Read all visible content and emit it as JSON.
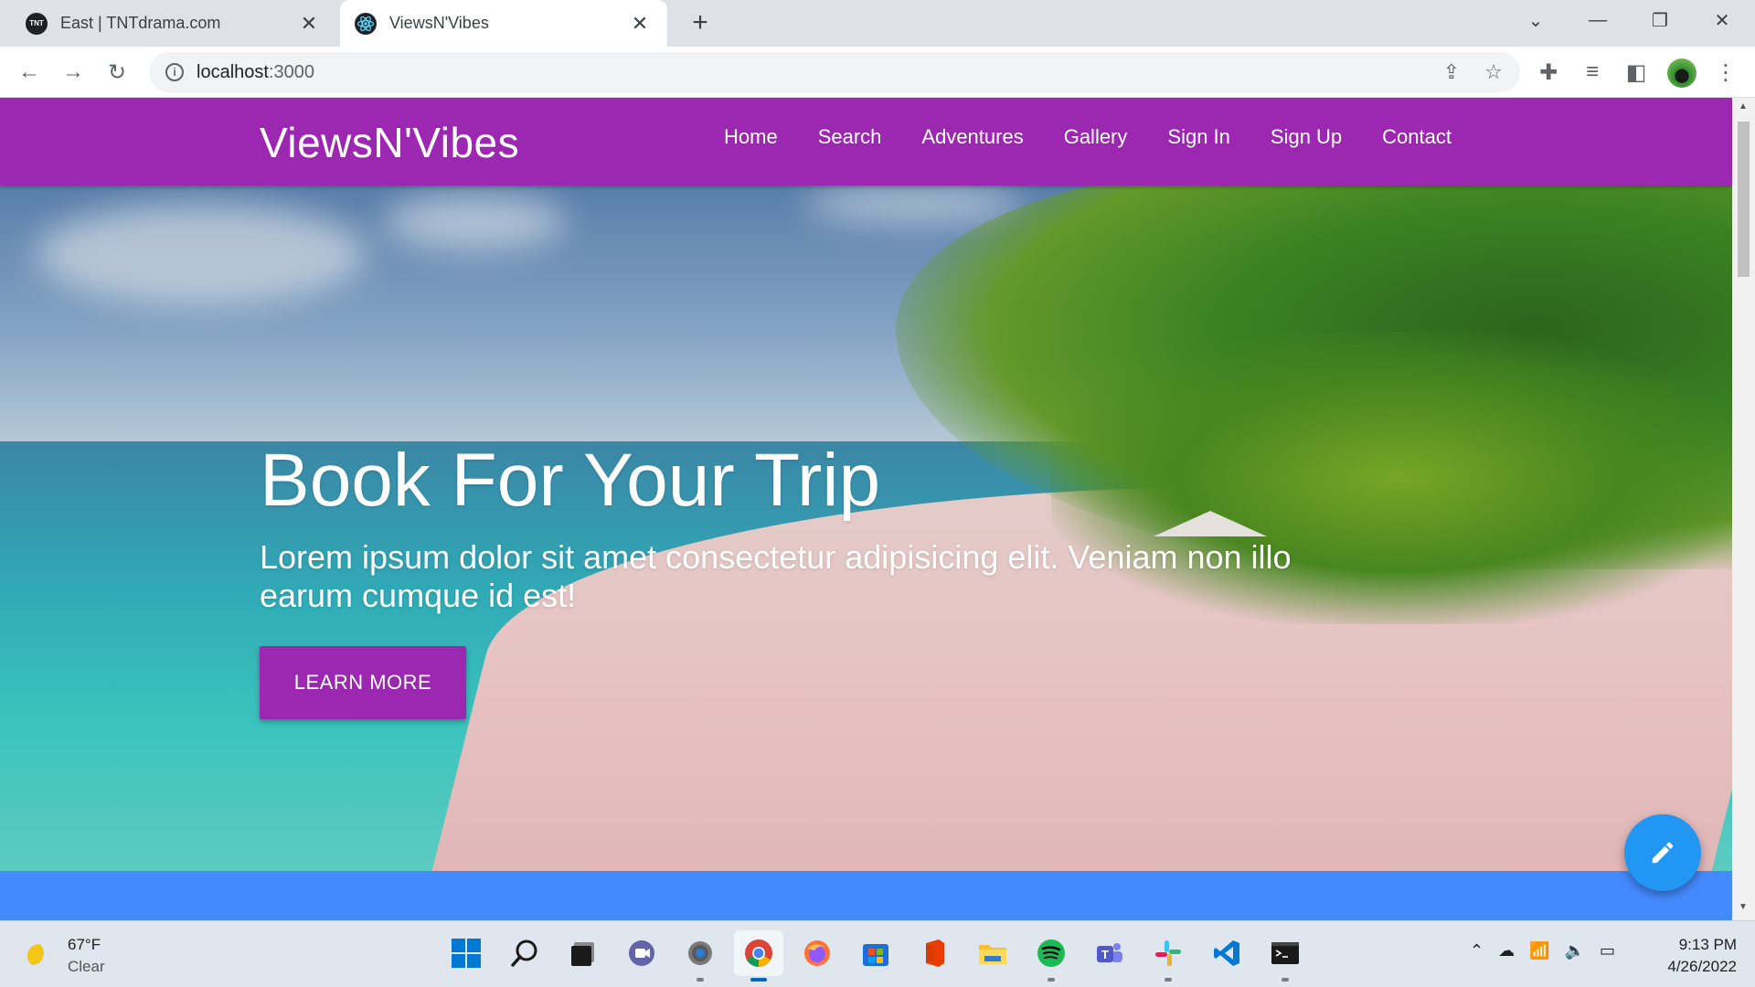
{
  "browser": {
    "tabs": [
      {
        "title": "East | TNTdrama.com",
        "favicon": "TNT",
        "active": false
      },
      {
        "title": "ViewsN'Vibes",
        "favicon": "react-icon",
        "active": true
      }
    ],
    "new_tab_label": "+",
    "url_host": "localhost",
    "url_port": ":3000"
  },
  "site": {
    "brand": "ViewsN'Vibes",
    "nav": [
      "Home",
      "Search",
      "Adventures",
      "Gallery",
      "Sign In",
      "Sign Up",
      "Contact"
    ],
    "hero": {
      "title": "Book For Your Trip",
      "text": "Lorem ipsum dolor sit amet consectetur adipisicing elit. Veniam non illo earum cumque id est!",
      "button": "LEARN MORE"
    },
    "colors": {
      "primary": "#9c27b0",
      "band": "#448aff",
      "fab": "#2196f3"
    }
  },
  "taskbar": {
    "weather_temp": "67°F",
    "weather_cond": "Clear",
    "time": "9:13 PM",
    "date": "4/26/2022",
    "apps": [
      "start",
      "search",
      "task-view",
      "chat",
      "settings",
      "chrome",
      "firefox",
      "store",
      "office",
      "file-explorer",
      "spotify",
      "teams",
      "slack",
      "vscode",
      "terminal"
    ]
  }
}
